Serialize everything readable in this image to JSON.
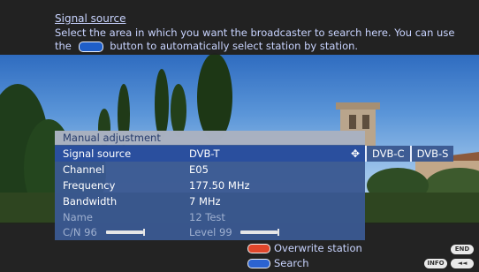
{
  "header": {
    "title": "Signal source",
    "desc_before_icon": "Select the area in which you want the broadcaster to search here. You can use the",
    "desc_after_icon": "button to automatically select station by station."
  },
  "menu": {
    "title": "Manual adjustment",
    "rows": [
      {
        "label": "Signal source",
        "value": "DVB-T"
      },
      {
        "label": "Channel",
        "value": "E05"
      },
      {
        "label": "Frequency",
        "value": "177.50 MHz"
      },
      {
        "label": "Bandwidth",
        "value": "7 MHz"
      },
      {
        "label": "Name",
        "value": "12 Test"
      },
      {
        "label": "C/N 96",
        "value": "Level 99"
      }
    ],
    "signal_strength": {
      "cn": 96,
      "level": 99
    },
    "signal_options": [
      "DVB-C",
      "DVB-S"
    ]
  },
  "footer": {
    "overwrite": "Overwrite station",
    "search": "Search",
    "end_key": "END",
    "info_key": "INFO",
    "back_key": "◄◄"
  },
  "colors": {
    "red_button": "#e0462b",
    "blue_button": "#2b63d1",
    "menu_bg": "#3a5891"
  }
}
